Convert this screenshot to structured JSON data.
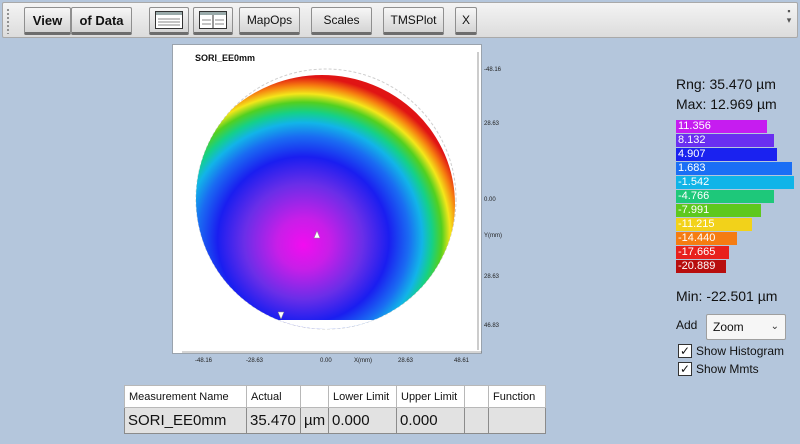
{
  "toolbar": {
    "view_label": "View",
    "of_data_label": "of Data",
    "layout1_icon": "single-panel-layout-icon",
    "layout2_icon": "split-panel-layout-icon",
    "mapops_label": "MapOps",
    "scales_label": "Scales",
    "tmsplot_label": "TMSPlot",
    "close_label": "X"
  },
  "plot": {
    "title": "SORI_EE0mm",
    "x_axis_label": "X(mm)",
    "y_axis_label": "Y(mm)",
    "x_ticks": [
      "-48.16",
      "-28.63",
      "0.00",
      "28.63",
      "48.61"
    ],
    "y_ticks": [
      "-48.16",
      "28.63",
      "0.00",
      "28.63",
      "46.83"
    ]
  },
  "stats": {
    "range": "Rng: 35.470 µm",
    "max": "Max: 12.969 µm",
    "min": "Min: -22.501 µm"
  },
  "histogram": [
    {
      "label": "11.356",
      "color": "#c61cf0",
      "fraction": 0.77
    },
    {
      "label": "8.132",
      "color": "#6a2ff0",
      "fraction": 0.83
    },
    {
      "label": "4.907",
      "color": "#1a22f0",
      "fraction": 0.86
    },
    {
      "label": "1.683",
      "color": "#1a6ef5",
      "fraction": 0.98
    },
    {
      "label": "-1.542",
      "color": "#10b4e8",
      "fraction": 1.0
    },
    {
      "label": "-4.766",
      "color": "#1ec87a",
      "fraction": 0.83
    },
    {
      "label": "-7.991",
      "color": "#5ec81e",
      "fraction": 0.72
    },
    {
      "label": "-11.215",
      "color": "#f2d21a",
      "fraction": 0.64
    },
    {
      "label": "-14.440",
      "color": "#f57c12",
      "fraction": 0.52
    },
    {
      "label": "-17.665",
      "color": "#e8201c",
      "fraction": 0.45
    },
    {
      "label": "-20.889",
      "color": "#b80e0e",
      "fraction": 0.42
    }
  ],
  "controls": {
    "add_label": "Add",
    "zoom_value": "Zoom",
    "show_histogram_label": "Show Histogram",
    "show_histogram_checked": true,
    "show_mmts_label": "Show Mmts",
    "show_mmts_checked": true
  },
  "measurements": {
    "columns": [
      "Measurement Name",
      "Actual",
      "",
      "Lower Limit",
      "Upper Limit",
      "",
      "Function"
    ],
    "rows": [
      [
        "SORI_EE0mm",
        "35.470",
        "µm",
        "0.000",
        "0.000",
        "",
        ""
      ]
    ]
  }
}
